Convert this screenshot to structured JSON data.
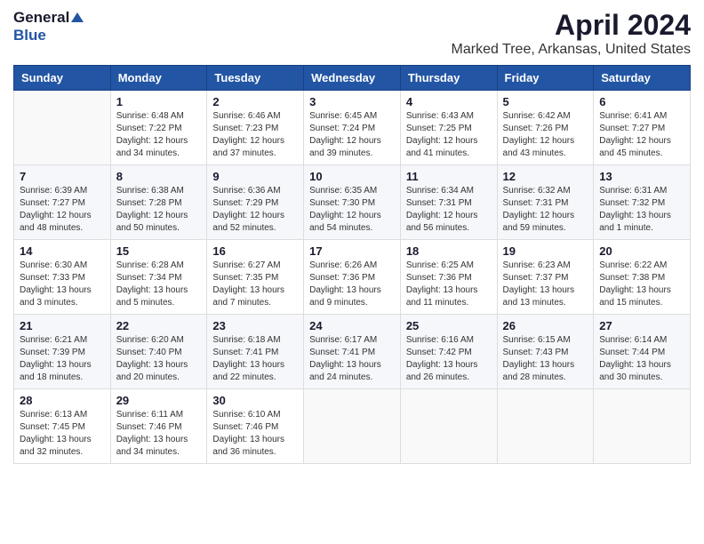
{
  "header": {
    "logo_general": "General",
    "logo_blue": "Blue",
    "title": "April 2024",
    "subtitle": "Marked Tree, Arkansas, United States"
  },
  "calendar": {
    "days_of_week": [
      "Sunday",
      "Monday",
      "Tuesday",
      "Wednesday",
      "Thursday",
      "Friday",
      "Saturday"
    ],
    "weeks": [
      [
        {
          "day": "",
          "info": ""
        },
        {
          "day": "1",
          "info": "Sunrise: 6:48 AM\nSunset: 7:22 PM\nDaylight: 12 hours\nand 34 minutes."
        },
        {
          "day": "2",
          "info": "Sunrise: 6:46 AM\nSunset: 7:23 PM\nDaylight: 12 hours\nand 37 minutes."
        },
        {
          "day": "3",
          "info": "Sunrise: 6:45 AM\nSunset: 7:24 PM\nDaylight: 12 hours\nand 39 minutes."
        },
        {
          "day": "4",
          "info": "Sunrise: 6:43 AM\nSunset: 7:25 PM\nDaylight: 12 hours\nand 41 minutes."
        },
        {
          "day": "5",
          "info": "Sunrise: 6:42 AM\nSunset: 7:26 PM\nDaylight: 12 hours\nand 43 minutes."
        },
        {
          "day": "6",
          "info": "Sunrise: 6:41 AM\nSunset: 7:27 PM\nDaylight: 12 hours\nand 45 minutes."
        }
      ],
      [
        {
          "day": "7",
          "info": "Sunrise: 6:39 AM\nSunset: 7:27 PM\nDaylight: 12 hours\nand 48 minutes."
        },
        {
          "day": "8",
          "info": "Sunrise: 6:38 AM\nSunset: 7:28 PM\nDaylight: 12 hours\nand 50 minutes."
        },
        {
          "day": "9",
          "info": "Sunrise: 6:36 AM\nSunset: 7:29 PM\nDaylight: 12 hours\nand 52 minutes."
        },
        {
          "day": "10",
          "info": "Sunrise: 6:35 AM\nSunset: 7:30 PM\nDaylight: 12 hours\nand 54 minutes."
        },
        {
          "day": "11",
          "info": "Sunrise: 6:34 AM\nSunset: 7:31 PM\nDaylight: 12 hours\nand 56 minutes."
        },
        {
          "day": "12",
          "info": "Sunrise: 6:32 AM\nSunset: 7:31 PM\nDaylight: 12 hours\nand 59 minutes."
        },
        {
          "day": "13",
          "info": "Sunrise: 6:31 AM\nSunset: 7:32 PM\nDaylight: 13 hours\nand 1 minute."
        }
      ],
      [
        {
          "day": "14",
          "info": "Sunrise: 6:30 AM\nSunset: 7:33 PM\nDaylight: 13 hours\nand 3 minutes."
        },
        {
          "day": "15",
          "info": "Sunrise: 6:28 AM\nSunset: 7:34 PM\nDaylight: 13 hours\nand 5 minutes."
        },
        {
          "day": "16",
          "info": "Sunrise: 6:27 AM\nSunset: 7:35 PM\nDaylight: 13 hours\nand 7 minutes."
        },
        {
          "day": "17",
          "info": "Sunrise: 6:26 AM\nSunset: 7:36 PM\nDaylight: 13 hours\nand 9 minutes."
        },
        {
          "day": "18",
          "info": "Sunrise: 6:25 AM\nSunset: 7:36 PM\nDaylight: 13 hours\nand 11 minutes."
        },
        {
          "day": "19",
          "info": "Sunrise: 6:23 AM\nSunset: 7:37 PM\nDaylight: 13 hours\nand 13 minutes."
        },
        {
          "day": "20",
          "info": "Sunrise: 6:22 AM\nSunset: 7:38 PM\nDaylight: 13 hours\nand 15 minutes."
        }
      ],
      [
        {
          "day": "21",
          "info": "Sunrise: 6:21 AM\nSunset: 7:39 PM\nDaylight: 13 hours\nand 18 minutes."
        },
        {
          "day": "22",
          "info": "Sunrise: 6:20 AM\nSunset: 7:40 PM\nDaylight: 13 hours\nand 20 minutes."
        },
        {
          "day": "23",
          "info": "Sunrise: 6:18 AM\nSunset: 7:41 PM\nDaylight: 13 hours\nand 22 minutes."
        },
        {
          "day": "24",
          "info": "Sunrise: 6:17 AM\nSunset: 7:41 PM\nDaylight: 13 hours\nand 24 minutes."
        },
        {
          "day": "25",
          "info": "Sunrise: 6:16 AM\nSunset: 7:42 PM\nDaylight: 13 hours\nand 26 minutes."
        },
        {
          "day": "26",
          "info": "Sunrise: 6:15 AM\nSunset: 7:43 PM\nDaylight: 13 hours\nand 28 minutes."
        },
        {
          "day": "27",
          "info": "Sunrise: 6:14 AM\nSunset: 7:44 PM\nDaylight: 13 hours\nand 30 minutes."
        }
      ],
      [
        {
          "day": "28",
          "info": "Sunrise: 6:13 AM\nSunset: 7:45 PM\nDaylight: 13 hours\nand 32 minutes."
        },
        {
          "day": "29",
          "info": "Sunrise: 6:11 AM\nSunset: 7:46 PM\nDaylight: 13 hours\nand 34 minutes."
        },
        {
          "day": "30",
          "info": "Sunrise: 6:10 AM\nSunset: 7:46 PM\nDaylight: 13 hours\nand 36 minutes."
        },
        {
          "day": "",
          "info": ""
        },
        {
          "day": "",
          "info": ""
        },
        {
          "day": "",
          "info": ""
        },
        {
          "day": "",
          "info": ""
        }
      ]
    ]
  }
}
